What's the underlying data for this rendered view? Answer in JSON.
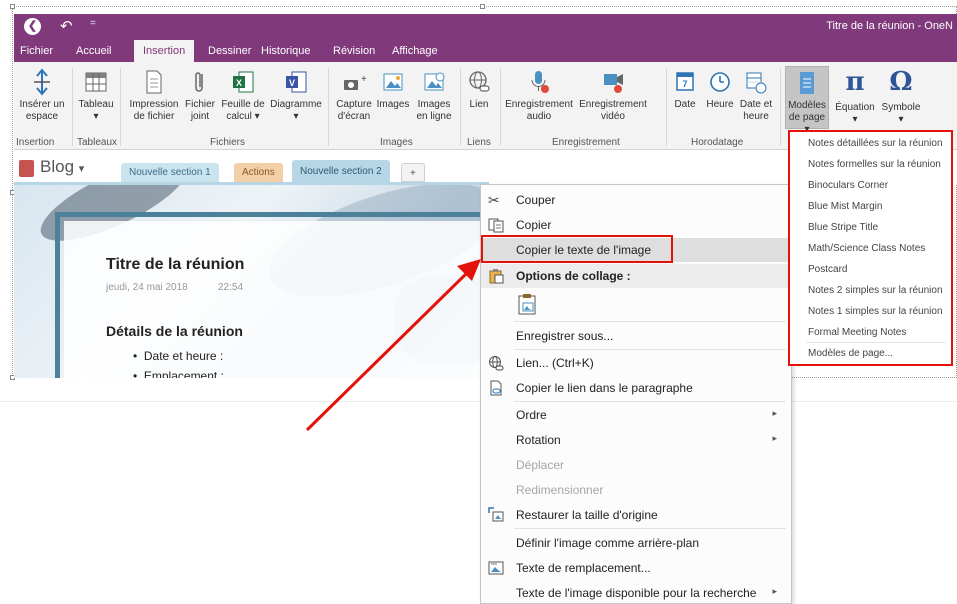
{
  "app": {
    "window_title": "Titre de la réunion - OneN",
    "colors": {
      "brand": "#80397b",
      "ribbon_bg": "#f3f3f3",
      "highlight_red": "#e3120b",
      "arrow_red": "#e3120b"
    }
  },
  "quick_access": {
    "back_icon": "back-circle-icon",
    "undo_icon": "undo-icon",
    "customize_symbol": "="
  },
  "ribbon_tabs": [
    "Fichier",
    "Accueil",
    "Insertion",
    "Dessiner",
    "Historique",
    "Révision",
    "Affichage"
  ],
  "ribbon_active_tab": "Insertion",
  "ribbon": {
    "insert_space": {
      "line1": "Insérer un",
      "line2": "espace"
    },
    "table": {
      "line1": "Tableau",
      "line2": "▾"
    },
    "file_printout": {
      "line1": "Impression",
      "line2": "de fichier"
    },
    "attach_file": {
      "line1": "Fichier",
      "line2": "joint"
    },
    "spreadsheet": {
      "line1": "Feuille de",
      "line2": "calcul ▾"
    },
    "diagram": {
      "line1": "Diagramme",
      "line2": "▾"
    },
    "screen_clipping": {
      "line1": "Capture",
      "line2": "d'écran"
    },
    "pictures": {
      "line1": "Images",
      "line2": ""
    },
    "online_pictures": {
      "line1": "Images",
      "line2": "en ligne"
    },
    "link": {
      "line1": "Lien",
      "line2": ""
    },
    "audio": {
      "line1": "Enregistrement",
      "line2": "audio"
    },
    "video": {
      "line1": "Enregistrement",
      "line2": "vidéo"
    },
    "date": {
      "line1": "Date",
      "line2": ""
    },
    "time": {
      "line1": "Heure",
      "line2": ""
    },
    "date_time": {
      "line1": "Date et",
      "line2": "heure"
    },
    "page_templates": {
      "line1": "Modèles",
      "line2": "de page ▾"
    },
    "equation": {
      "line1": "Équation",
      "line2": "▾"
    },
    "symbol": {
      "line1": "Symbole",
      "line2": "▾"
    },
    "groups": {
      "insertion": "Insertion",
      "tableaux": "Tableaux",
      "fichiers": "Fichiers",
      "images": "Images",
      "liens": "Liens",
      "enregistrement": "Enregistrement",
      "horodatage": "Horodatage"
    }
  },
  "notebook": {
    "name": "Blog",
    "dropdown": "▾",
    "sections": [
      {
        "label": "Nouvelle section 1",
        "color": "#c9e3ef"
      },
      {
        "label": "Actions",
        "color": "#f2cfa6"
      },
      {
        "label": "Nouvelle section 2",
        "color": "#b8d7e6"
      }
    ],
    "add_tab": "+"
  },
  "page": {
    "title": "Titre de la réunion",
    "date": "jeudi, 24 mai 2018",
    "time": "22:54",
    "heading": "Détails de la réunion",
    "bullet1": "Date et heure :",
    "bullet2": "Emplacement :"
  },
  "context_menu": {
    "cut": "Couper",
    "copy": "Copier",
    "copy_image_text": "Copier le texte de l'image",
    "paste_options": "Options de collage :",
    "save_as": "Enregistrer sous...",
    "link": "Lien...  (Ctrl+K)",
    "copy_link_paragraph": "Copier le lien dans le paragraphe",
    "order": "Ordre",
    "rotation": "Rotation",
    "move": "Déplacer",
    "resize": "Redimensionner",
    "restore_size": "Restaurer la taille d'origine",
    "set_background": "Définir l'image comme arrière-plan",
    "alt_text": "Texte de remplacement...",
    "searchable_text": "Texte de l'image disponible pour la recherche",
    "submenu_arrow": "▸"
  },
  "templates_menu": {
    "items": [
      "Notes détaillées sur la réunion",
      "Notes formelles sur la réunion",
      "Binoculars Corner",
      "Blue Mist Margin",
      "Blue Stripe Title",
      "Math/Science Class Notes",
      "Postcard",
      "Notes 2 simples sur la réunion",
      "Notes 1 simples sur la réunion",
      "Formal Meeting Notes"
    ],
    "more": "Modèles de page..."
  }
}
